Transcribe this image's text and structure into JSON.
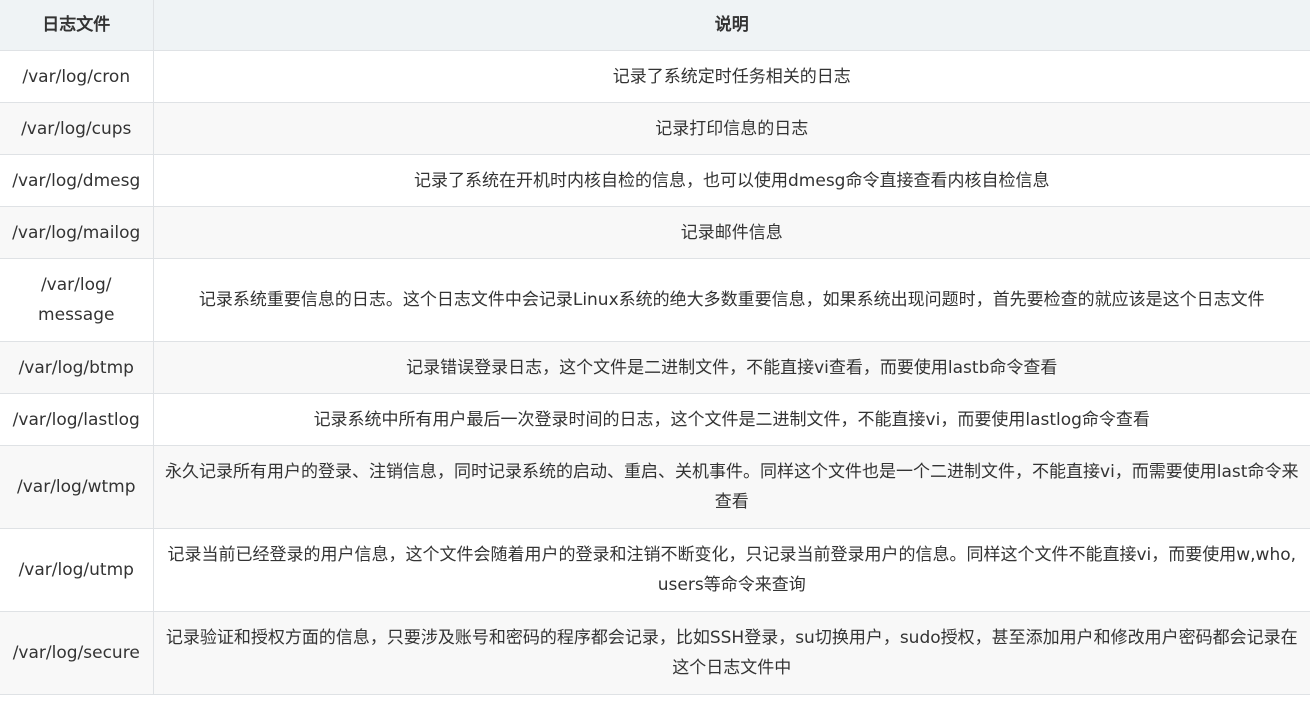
{
  "table": {
    "headers": [
      "日志文件",
      "说明"
    ],
    "rows": [
      {
        "file": "/var/log/cron",
        "desc": "记录了系统定时任务相关的日志"
      },
      {
        "file": "/var/log/cups",
        "desc": "记录打印信息的日志"
      },
      {
        "file": "/var/log/dmesg",
        "desc": "记录了系统在开机时内核自检的信息，也可以使用dmesg命令直接查看内核自检信息"
      },
      {
        "file": "/var/log/mailog",
        "desc": "记录邮件信息"
      },
      {
        "file": "/var/log/\nmessage",
        "desc": "记录系统重要信息的日志。这个日志文件中会记录Linux系统的绝大多数重要信息，如果系统出现问题时，首先要检查的就应该是这个日志文件"
      },
      {
        "file": "/var/log/btmp",
        "desc": "记录错误登录日志，这个文件是二进制文件，不能直接vi查看，而要使用lastb命令查看"
      },
      {
        "file": "/var/log/lastlog",
        "desc": "记录系统中所有用户最后一次登录时间的日志，这个文件是二进制文件，不能直接vi，而要使用lastlog命令查看"
      },
      {
        "file": "/var/log/wtmp",
        "desc": "永久记录所有用户的登录、注销信息，同时记录系统的启动、重启、关机事件。同样这个文件也是一个二进制文件，不能直接vi，而需要使用last命令来查看"
      },
      {
        "file": "/var/log/utmp",
        "desc": "记录当前已经登录的用户信息，这个文件会随着用户的登录和注销不断变化，只记录当前登录用户的信息。同样这个文件不能直接vi，而要使用w,who,users等命令来查询"
      },
      {
        "file": "/var/log/secure",
        "desc": "记录验证和授权方面的信息，只要涉及账号和密码的程序都会记录，比如SSH登录，su切换用户，sudo授权，甚至添加用户和修改用户密码都会记录在这个日志文件中"
      }
    ]
  }
}
